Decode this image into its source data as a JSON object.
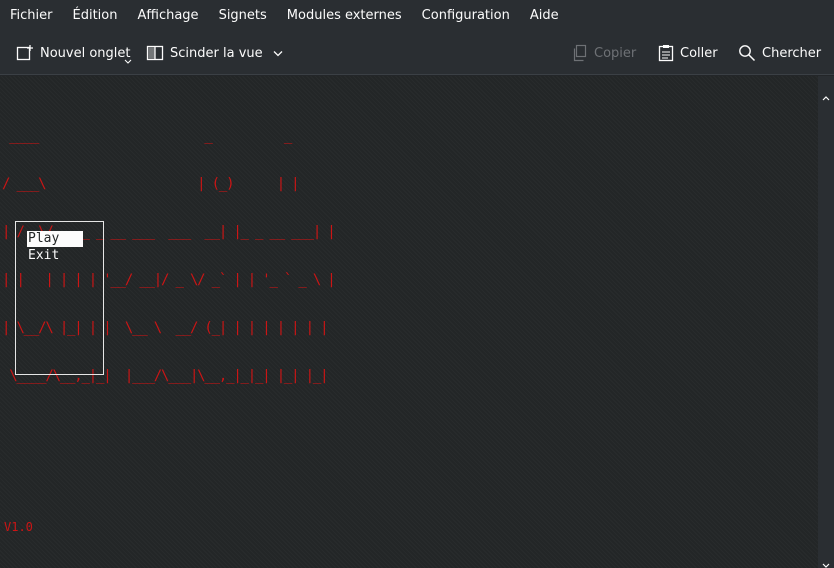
{
  "menubar": {
    "items": [
      "Fichier",
      "Édition",
      "Affichage",
      "Signets",
      "Modules externes",
      "Configuration",
      "Aide"
    ]
  },
  "toolbar": {
    "new_tab": "Nouvel onglet",
    "split_view": "Scinder la vue",
    "copy": "Copier",
    "paste": "Coller",
    "search": "Chercher"
  },
  "terminal": {
    "banner_lines": [
      " ____                       _          _ ",
      "/ ___\\                     | (_)      | |",
      "| /  \\/_   _ _ __ ___  ___  __| |_ _ __ ___| |",
      "| |   | | | | '__/ __|/ _ \\/ _` | | '_ ` _ \\ |",
      "| \\__/\\ |_| | |  \\__ \\  __/ (_| | | | | | | |",
      " \\____/\\__,_|_|  |___/\\___|\\__,_|_|_| |_| |_|"
    ],
    "menu_options": [
      "Play",
      "Exit"
    ],
    "version": "V1.0"
  },
  "colors": {
    "banner": "#cc1515",
    "terminal_bg": "#232627",
    "chrome_bg": "#2a2e32"
  }
}
